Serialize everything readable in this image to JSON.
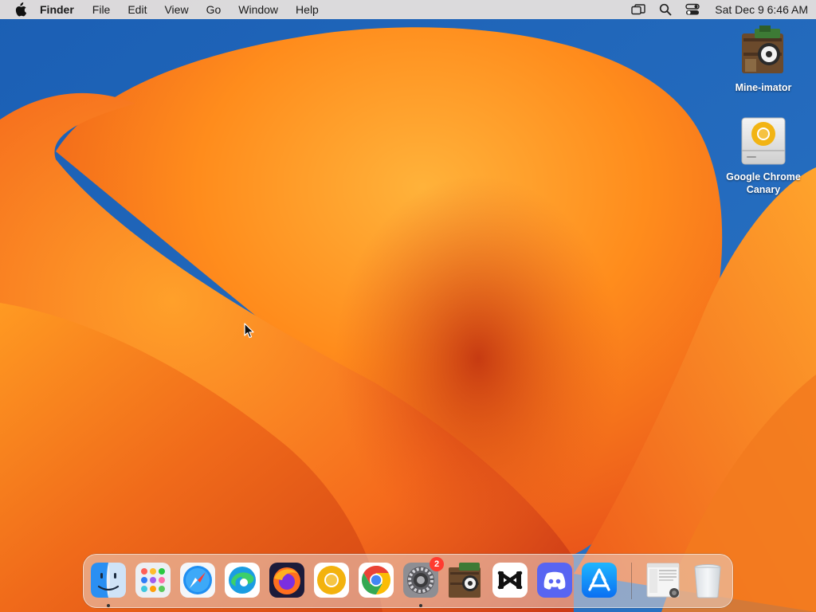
{
  "menubar": {
    "apple_icon": "apple-logo-icon",
    "app_name": "Finder",
    "menus": [
      "File",
      "Edit",
      "View",
      "Go",
      "Window",
      "Help"
    ],
    "status_icons": [
      "screen-mirroring-icon",
      "spotlight-search-icon",
      "control-center-icon"
    ],
    "clock": "Sat Dec 9  6:46 AM"
  },
  "desktop": {
    "icons": [
      {
        "label": "Mine-imator",
        "icon": "mine-imator-icon"
      },
      {
        "label": "Google Chrome Canary",
        "icon": "chrome-canary-disk-icon"
      }
    ]
  },
  "dock": {
    "items": [
      {
        "icon": "finder-icon",
        "running": true
      },
      {
        "icon": "launchpad-icon",
        "running": false
      },
      {
        "icon": "safari-icon",
        "running": false
      },
      {
        "icon": "edge-icon",
        "running": false
      },
      {
        "icon": "firefox-icon",
        "running": false
      },
      {
        "icon": "chrome-canary-icon",
        "running": false
      },
      {
        "icon": "chrome-icon",
        "running": false
      },
      {
        "icon": "system-settings-icon",
        "running": true,
        "badge": "2"
      },
      {
        "icon": "mine-imator-icon",
        "running": false
      },
      {
        "icon": "capcut-icon",
        "running": false
      },
      {
        "icon": "discord-icon",
        "running": false
      },
      {
        "icon": "app-store-icon",
        "running": false
      },
      {
        "icon": "downloads-stack-icon",
        "running": false
      },
      {
        "icon": "trash-icon",
        "running": false
      }
    ]
  },
  "colors": {
    "wallpaper_orange": "#ff8a1a",
    "wallpaper_blue": "#1f63b5",
    "badge_red": "#ff3b30"
  }
}
